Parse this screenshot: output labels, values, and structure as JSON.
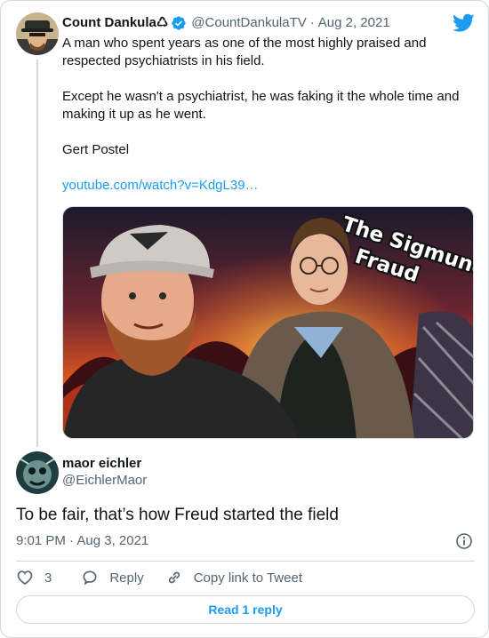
{
  "parent_tweet": {
    "author_name": "Count Dankula♺",
    "handle": "@CountDankulaTV",
    "separator": "·",
    "date": "Aug 2, 2021",
    "text_lines": [
      "A man who spent years as one of the most highly praised and respected psychiatrists in his field.",
      "Except he wasn't a psychiatrist, he was faking it the whole time and making it up as he went.",
      "Gert Postel"
    ],
    "link": "youtube.com/watch?v=KdgL39…",
    "media": {
      "overlay_line1": "The Sigmund",
      "overlay_line2": "Fraud"
    }
  },
  "reply_tweet": {
    "author_name": "maor eichler",
    "handle": "@EichlerMaor",
    "text": "To be fair, that’s how Freud started the field",
    "timestamp": "9:01 PM · Aug 3, 2021"
  },
  "actions": {
    "like_count": "3",
    "reply_label": "Reply",
    "copy_link_label": "Copy link to Tweet"
  },
  "read_replies_label": "Read 1 reply",
  "icons": {
    "verified": "verified-badge-icon",
    "brand": "twitter-bird-icon",
    "info": "info-icon",
    "like": "heart-icon",
    "reply": "speech-bubble-icon",
    "copy_link": "link-icon"
  },
  "colors": {
    "accent": "#1d9bf0",
    "text": "#0f1419",
    "secondary": "#536471",
    "border": "#cfd9de"
  }
}
